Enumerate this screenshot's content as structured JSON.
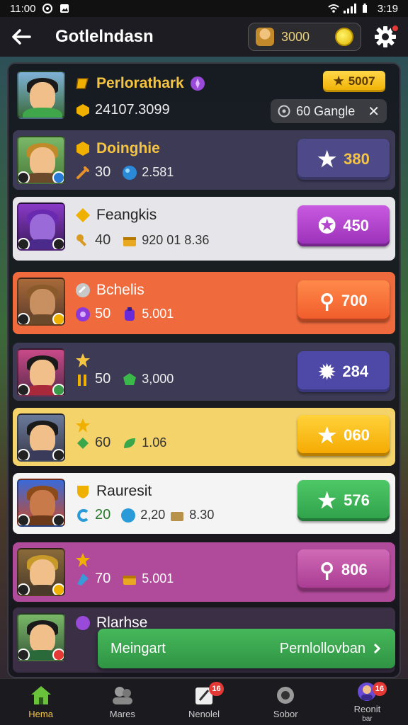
{
  "status_bar": {
    "time_left": "11:00",
    "time_right": "3:19"
  },
  "header": {
    "title": "Gotlelndasn",
    "coins": "3000"
  },
  "top_player": {
    "name": "Perlorathark",
    "score": "24107.3099",
    "pill_label": "5007",
    "ad_label": "60 Gangle"
  },
  "rows": [
    {
      "name": "Doinghie",
      "stat1": "30",
      "stat2": "2.581",
      "button": "380",
      "theme": "slate"
    },
    {
      "name": "Feangkis",
      "stat1": "40",
      "stat2": "920 01 8.36",
      "button": "450",
      "theme": "light"
    },
    {
      "name": "Bchelis",
      "stat1": "50",
      "stat2": "5.001",
      "button": "700",
      "theme": "orange"
    },
    {
      "name": "",
      "stat1": "50",
      "stat2": "3,000",
      "button": "284",
      "theme": "slate"
    },
    {
      "name": "",
      "stat1": "60",
      "stat2": "1.06",
      "button": "060",
      "theme": "yellow"
    },
    {
      "name": "Rauresit",
      "stat1": "20",
      "stat2": "2,20",
      "stat3": "8.30",
      "button": "576",
      "theme": "white"
    },
    {
      "name": "",
      "stat1": "70",
      "stat2": "5.001",
      "button": "806",
      "theme": "magenta"
    },
    {
      "name": "Rlarhse",
      "stat1": "",
      "stat2": "",
      "button": "",
      "theme": "dark"
    }
  ],
  "promo": {
    "left_label": "Meingart",
    "right_label": "Pernlollovban"
  },
  "bottom_nav": [
    {
      "label": "Hema",
      "icon": "home-icon",
      "active": true
    },
    {
      "label": "Mares",
      "icon": "friends-icon",
      "active": false
    },
    {
      "label": "Nenolel",
      "icon": "quest-icon",
      "active": false,
      "badge": "16"
    },
    {
      "label": "Sobor",
      "icon": "camera-icon",
      "active": false
    },
    {
      "label": "Reonit",
      "icon": "profile-icon",
      "active": false,
      "badge": "16",
      "sublabel": "bar"
    }
  ],
  "colors": {
    "slate_row": "#3c3a55",
    "light_row": "#e6e6ea",
    "orange_row": "#ef6a3c",
    "yellow_row": "#f3d36a",
    "white_row": "#f4f4f4",
    "magenta_row": "#b04a9a",
    "purple_btn": "#b046c8",
    "orange_btn": "#ff7a3a",
    "green_btn": "#3fbe5a",
    "yellow_btn": "#ffc21a",
    "indigo_btn": "#4e49a6",
    "pink_btn": "#c45aa8"
  }
}
